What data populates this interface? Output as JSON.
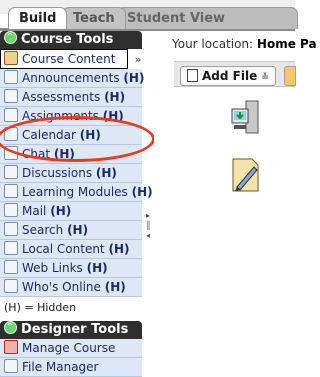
{
  "tabs": [
    {
      "label": "Build"
    },
    {
      "label": "Teach"
    },
    {
      "label": "Student View"
    }
  ],
  "course_tools": {
    "title": "Course Tools",
    "selected": "Course Content",
    "dropdown_glyph": "»",
    "items": [
      {
        "label": "Announcements",
        "suffix": "(H)",
        "icon": "announcement-icon"
      },
      {
        "label": "Assessments",
        "suffix": "(H)",
        "icon": "assessment-icon"
      },
      {
        "label": "Assignments",
        "suffix": "(H)",
        "icon": "assignment-icon"
      },
      {
        "label": "Calendar",
        "suffix": "(H)",
        "icon": "calendar-icon"
      },
      {
        "label": "Chat",
        "suffix": "(H)",
        "icon": "chat-icon"
      },
      {
        "label": "Discussions",
        "suffix": "(H)",
        "icon": "discussion-icon"
      },
      {
        "label": "Learning Modules",
        "suffix": "(H)",
        "icon": "learning-modules-icon"
      },
      {
        "label": "Mail",
        "suffix": "(H)",
        "icon": "mail-icon"
      },
      {
        "label": "Search",
        "suffix": "(H)",
        "icon": "search-icon"
      },
      {
        "label": "Local Content",
        "suffix": "(H)",
        "icon": "local-content-icon"
      },
      {
        "label": "Web Links",
        "suffix": "(H)",
        "icon": "web-links-icon"
      },
      {
        "label": "Who's Online",
        "suffix": "(H)",
        "icon": "whos-online-icon"
      }
    ],
    "legend": "(H) = Hidden"
  },
  "designer_tools": {
    "title": "Designer Tools",
    "items": [
      {
        "label": "Manage Course",
        "icon": "manage-course-icon"
      },
      {
        "label": "File Manager",
        "icon": "file-manager-icon"
      }
    ]
  },
  "content": {
    "location_prefix": "Your location:",
    "location_value": "Home Pa",
    "add_file_label": "Add File",
    "dropdown_glyph": "≚"
  },
  "colors": {
    "panel_header": "#2f2f2f",
    "item_background": "#dde7f5",
    "highlight": "#e63b1f"
  }
}
